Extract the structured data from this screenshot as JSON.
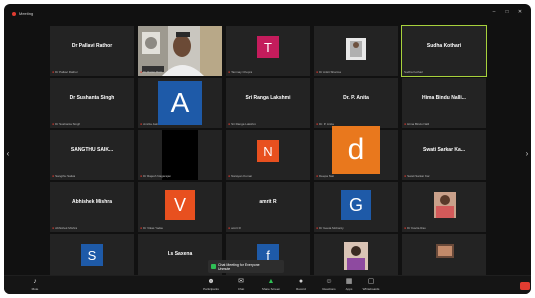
{
  "app_title": "Meeting",
  "gallery": [
    {
      "name": "Dr Pallavi Rathor",
      "label": "Dr Pallavi Rathor",
      "avatar": null
    },
    {
      "name": "",
      "label": "Dr Ratan Ram",
      "avatar": null
    },
    {
      "name": "",
      "label": "Tanmay Chopra",
      "avatar": {
        "letter": "T",
        "color": "#c41c5c"
      }
    },
    {
      "name": "",
      "label": "Dr Ankit Sharma",
      "avatar": null
    },
    {
      "name": "Sudha Kothari",
      "label": "Sudha Kothari",
      "avatar": null
    },
    {
      "name": "Dr Sushanta Singh",
      "label": "Dr Sushanta Singh",
      "avatar": null
    },
    {
      "name": "",
      "label": "Amrita Jain",
      "avatar": {
        "letter": "A",
        "color": "#1e5aa8"
      }
    },
    {
      "name": "Sri Ranga Lakshmi",
      "label": "Sri Ranga Lakshmi",
      "avatar": null
    },
    {
      "name": "Dr. P. Anita",
      "label": "Dr. P. Anita",
      "avatar": null
    },
    {
      "name": "Hima Bindu Nalli...",
      "label": "Hima Bindu Nalli",
      "avatar": null
    },
    {
      "name": "SANGTHU SAIK...",
      "label": "Sangthu Saikia",
      "avatar": null
    },
    {
      "name": "",
      "label": "Dr Rajesh Nagarajan",
      "avatar": null
    },
    {
      "name": "",
      "label": "Narayan Kumar",
      "avatar": {
        "letter": "N",
        "color": "#e8501f"
      }
    },
    {
      "name": "",
      "label": "Deepa Nair",
      "avatar": {
        "letter": "d",
        "color": "#e9781d"
      }
    },
    {
      "name": "Swati Sarkar Ka...",
      "label": "Swati Sarkar Kar",
      "avatar": null
    },
    {
      "name": "Abhishek Mishra",
      "label": "Abhishek Mishra",
      "avatar": null
    },
    {
      "name": "",
      "label": "Dr Vikas Yadav",
      "avatar": {
        "letter": "V",
        "color": "#e8501f"
      }
    },
    {
      "name": "amrit R",
      "label": "amrit R",
      "avatar": null
    },
    {
      "name": "",
      "label": "Dr Geeta Mohanty",
      "avatar": {
        "letter": "G",
        "color": "#1e5aa8"
      }
    },
    {
      "name": "",
      "label": "Dr Kavita Rao",
      "avatar": null
    },
    {
      "name": "",
      "label": "Sourav Paul",
      "avatar": {
        "letter": "S",
        "color": "#1e5aa8"
      }
    },
    {
      "name": "I.s Saxena",
      "label": "I.s Saxena",
      "avatar": null
    },
    {
      "name": "",
      "label": "Dr Fatima",
      "avatar": {
        "letter": "f",
        "color": "#1e5aa8"
      }
    },
    {
      "name": "",
      "label": "Sunitha Rani",
      "avatar": null
    },
    {
      "name": "",
      "label": "Jyoti Bala",
      "avatar": null
    }
  ],
  "notification": {
    "text": "Chat Meeting for Everyone",
    "sub": "Unmute"
  },
  "toolbar": {
    "items": [
      {
        "label": "Mute",
        "icon": "microphone-icon"
      },
      {
        "label": "Participants",
        "icon": "participants-icon"
      },
      {
        "label": "Chat",
        "icon": "chat-icon"
      },
      {
        "label": "Share Screen",
        "icon": "share-screen-icon"
      },
      {
        "label": "Record",
        "icon": "record-icon"
      },
      {
        "label": "Reactions",
        "icon": "reactions-icon"
      },
      {
        "label": "Apps",
        "icon": "apps-icon"
      },
      {
        "label": "Whiteboards",
        "icon": "whiteboard-icon"
      }
    ],
    "end_label": ""
  },
  "colors": {
    "background": "#111111",
    "tile": "#232323",
    "active_speaker": "#a7d13c",
    "muted": "#e03c31"
  }
}
